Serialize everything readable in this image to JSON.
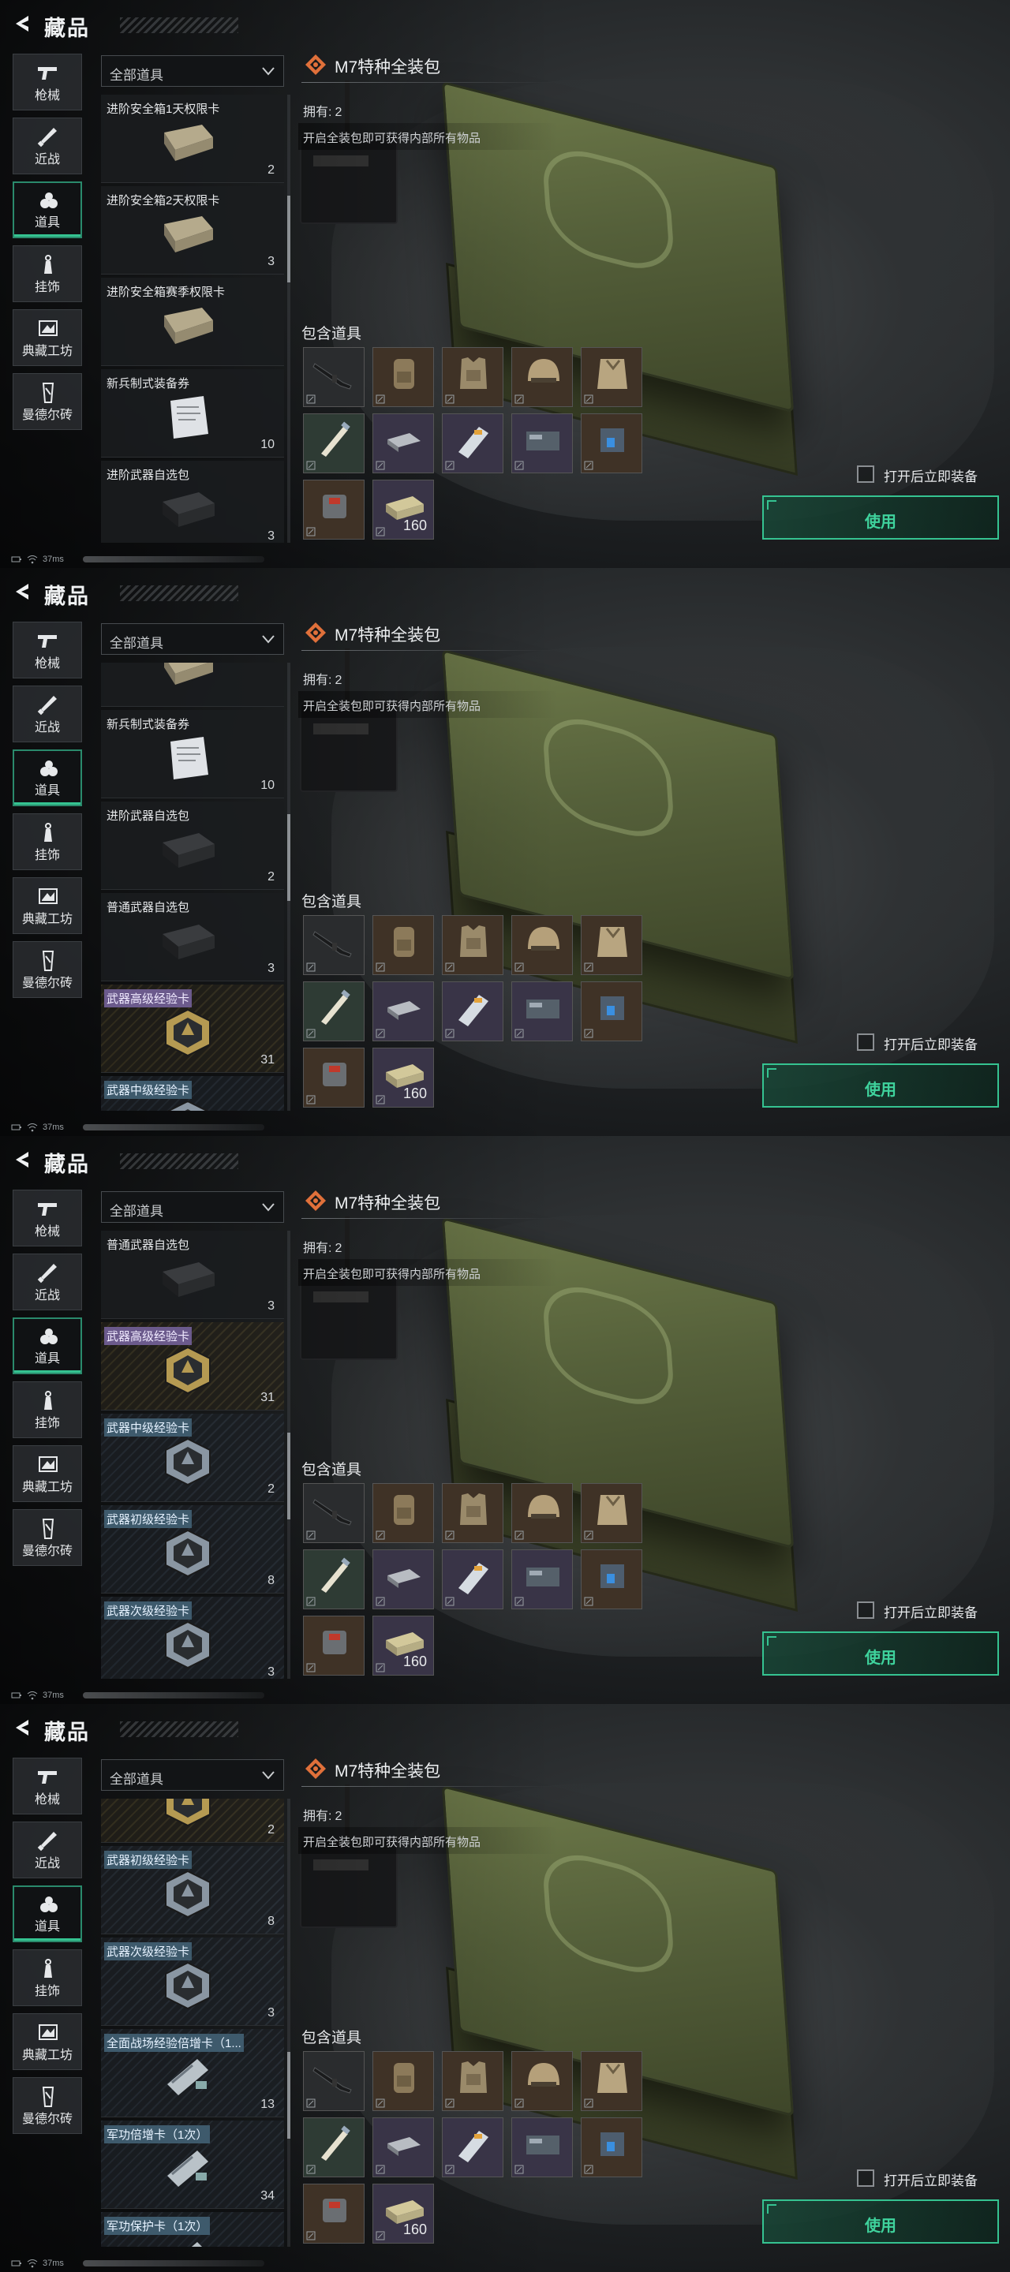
{
  "app": {
    "title": "藏品"
  },
  "nav": [
    {
      "label": "枪械",
      "icon": "gun-icon"
    },
    {
      "label": "近战",
      "icon": "knife-icon"
    },
    {
      "label": "道具",
      "icon": "items-icon",
      "active": true
    },
    {
      "label": "挂饰",
      "icon": "charm-icon"
    },
    {
      "label": "典藏工坊",
      "icon": "workshop-icon"
    },
    {
      "label": "曼德尔砖",
      "icon": "mandel-brick-icon"
    }
  ],
  "filter": {
    "selected": "全部道具"
  },
  "detail": {
    "title": "M7特种全装包",
    "owned_label": "拥有:",
    "owned_value": "2",
    "description": "开启全装包即可获得内部所有物品",
    "contains_label": "包含道具",
    "contents": [
      {
        "name": "rifle-icon",
        "tone": "dark",
        "count": ""
      },
      {
        "name": "backpack-icon",
        "tone": "brown",
        "count": ""
      },
      {
        "name": "vest-icon",
        "tone": "brown",
        "count": ""
      },
      {
        "name": "helmet-icon",
        "tone": "brown",
        "count": ""
      },
      {
        "name": "armor-icon",
        "tone": "brown",
        "count": ""
      },
      {
        "name": "syringe-icon",
        "tone": "green",
        "count": ""
      },
      {
        "name": "medkit-icon",
        "tone": "purple",
        "count": ""
      },
      {
        "name": "injector-icon",
        "tone": "purple",
        "count": ""
      },
      {
        "name": "card-icon",
        "tone": "purple",
        "count": ""
      },
      {
        "name": "battery-icon",
        "tone": "brown",
        "count": ""
      },
      {
        "name": "bandage-icon",
        "tone": "brown",
        "count": ""
      },
      {
        "name": "ammo-box-icon",
        "tone": "purple",
        "count": "160"
      }
    ],
    "auto_equip_label": "打开后立即装备",
    "use_label": "使用"
  },
  "status": {
    "ping": "37ms"
  },
  "screens": [
    {
      "scroll_thumb": 0.28,
      "items": [
        {
          "name": "进阶安全箱1天权限卡",
          "count": "2",
          "style": "plain",
          "icon": "safe-box-icon"
        },
        {
          "name": "进阶安全箱2天权限卡",
          "count": "3",
          "style": "plain",
          "icon": "safe-box-icon"
        },
        {
          "name": "进阶安全箱赛季权限卡",
          "count": "",
          "style": "plain",
          "icon": "safe-box-icon"
        },
        {
          "name": "新兵制式装备券",
          "count": "10",
          "style": "plain",
          "icon": "voucher-icon"
        },
        {
          "name": "进阶武器自选包",
          "count": "3",
          "style": "plain",
          "icon": "weapon-case-icon"
        }
      ]
    },
    {
      "scroll_thumb": 0.42,
      "items": [
        {
          "name": "",
          "count": "",
          "style": "plain",
          "icon": "safe-box-icon"
        },
        {
          "name": "新兵制式装备券",
          "count": "10",
          "style": "plain",
          "icon": "voucher-icon"
        },
        {
          "name": "进阶武器自选包",
          "count": "2",
          "style": "plain",
          "icon": "weapon-case-icon"
        },
        {
          "name": "普通武器自选包",
          "count": "3",
          "style": "plain",
          "icon": "weapon-case-icon"
        },
        {
          "name": "武器高级经验卡",
          "count": "31",
          "style": "gold",
          "icon": "exp-card-icon"
        },
        {
          "name": "武器中级经验卡",
          "count": "",
          "style": "blue",
          "icon": "exp-card-icon"
        }
      ]
    },
    {
      "scroll_thumb": 0.56,
      "items": [
        {
          "name": "普通武器自选包",
          "count": "3",
          "style": "plain",
          "icon": "weapon-case-icon"
        },
        {
          "name": "武器高级经验卡",
          "count": "31",
          "style": "gold",
          "icon": "exp-card-icon"
        },
        {
          "name": "武器中级经验卡",
          "count": "2",
          "style": "blue",
          "icon": "exp-card-icon"
        },
        {
          "name": "武器初级经验卡",
          "count": "8",
          "style": "blue",
          "icon": "exp-card-icon"
        },
        {
          "name": "武器次级经验卡",
          "count": "3",
          "style": "blue",
          "icon": "exp-card-icon"
        }
      ]
    },
    {
      "scroll_thumb": 0.7,
      "items": [
        {
          "name": "",
          "count": "2",
          "style": "gold",
          "icon": "exp-card-icon"
        },
        {
          "name": "武器初级经验卡",
          "count": "8",
          "style": "blue",
          "icon": "exp-card-icon"
        },
        {
          "name": "武器次级经验卡",
          "count": "3",
          "style": "blue",
          "icon": "exp-card-icon"
        },
        {
          "name": "全面战场经验倍增卡（1...",
          "count": "13",
          "style": "blue",
          "icon": "boost-card-icon"
        },
        {
          "name": "军功倍增卡（1次）",
          "count": "34",
          "style": "blue",
          "icon": "boost-card-icon"
        },
        {
          "name": "军功保护卡（1次）",
          "count": "",
          "style": "blue",
          "icon": "boost-card-icon"
        }
      ]
    }
  ],
  "colors": {
    "accent": "#35c391",
    "gold_tag": "#6b5a8c",
    "blue_tag": "#3e5a6c"
  }
}
